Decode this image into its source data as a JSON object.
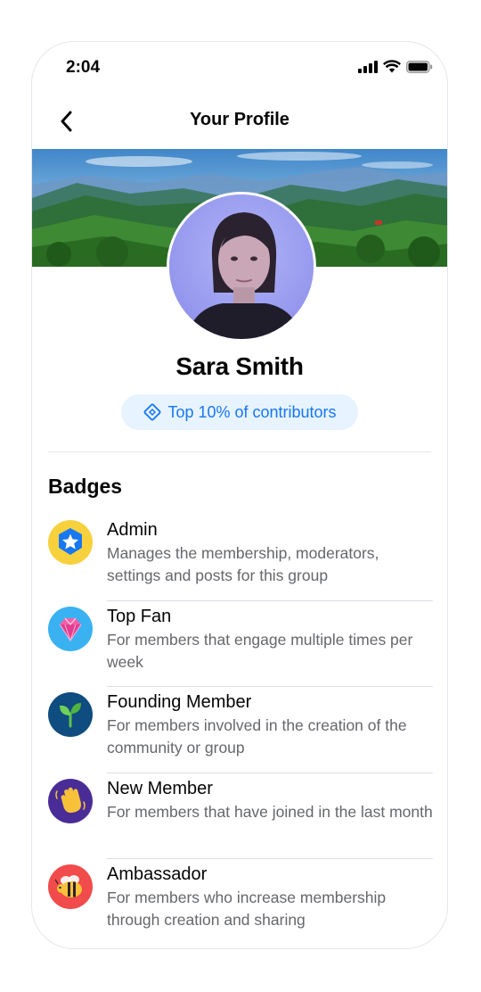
{
  "status_bar": {
    "time": "2:04",
    "icons": [
      "cellular-signal-icon",
      "wifi-icon",
      "battery-icon"
    ]
  },
  "nav": {
    "back_icon": "chevron-left-icon",
    "title": "Your Profile"
  },
  "profile": {
    "name": "Sara Smith",
    "contributor_badge": {
      "icon": "diamond-badge-icon",
      "label": "Top 10% of contributors"
    }
  },
  "badges": {
    "heading": "Badges",
    "items": [
      {
        "icon": "admin-star-shield-icon",
        "title": "Admin",
        "description": "Manages the membership, moderators, settings and posts for this group",
        "color": "#f7d13d"
      },
      {
        "icon": "diamond-gem-icon",
        "title": "Top Fan",
        "description": "For members that engage multiple times per week",
        "color": "#3ab2f2"
      },
      {
        "icon": "sprout-icon",
        "title": "Founding Member",
        "description": "For members involved in the creation of the community or group",
        "color": "#0f4c7f"
      },
      {
        "icon": "waving-hand-icon",
        "title": "New Member",
        "description": "For members that have joined in the last month",
        "color": "#4a2c97"
      },
      {
        "icon": "bee-icon",
        "title": "Ambassador",
        "description": "For members who increase membership through creation and sharing",
        "color": "#f24b4b"
      }
    ]
  },
  "colors": {
    "accent": "#1877f2",
    "pill_bg": "#e7f3ff",
    "secondary_text": "#65676b",
    "divider": "#e4e6eb"
  }
}
